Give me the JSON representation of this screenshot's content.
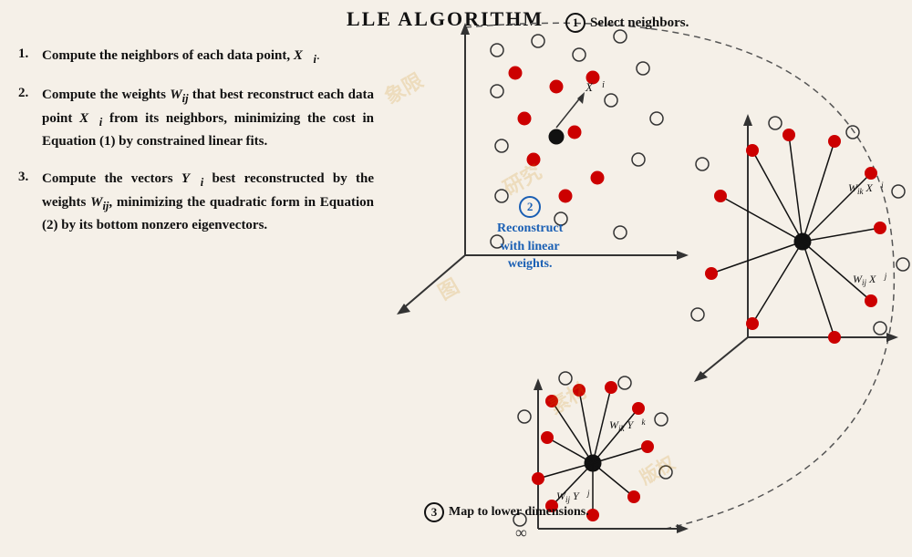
{
  "title": "LLE ALGORITHM",
  "steps": [
    {
      "number": "1.",
      "text": "Compute the neighbors of each data point, X̄ᵢ."
    },
    {
      "number": "2.",
      "text": "Compute the weights Wᵢⱼ that best reconstruct each data point X̄ᵢ from its neighbors, minimizing the cost in Equation (1) by constrained linear fits."
    },
    {
      "number": "3.",
      "text": "Compute the vectors Ȳᵢ best reconstructed by the weights Wᵢⱼ, minimizing the quadratic form in Equation (2) by its bottom nonzero eigenvectors."
    }
  ],
  "labels": {
    "step1": "Select neighbors.",
    "step2_line1": "Reconstruct",
    "step2_line2": "with linear",
    "step2_line3": "weights.",
    "step3": "Map to lower dimensions."
  },
  "colors": {
    "background": "#f5f0e8",
    "accent_blue": "#1a5fb4",
    "dot_red": "#cc0000",
    "dot_open": "#333",
    "arrow": "#111",
    "watermark": "#cc8800"
  }
}
